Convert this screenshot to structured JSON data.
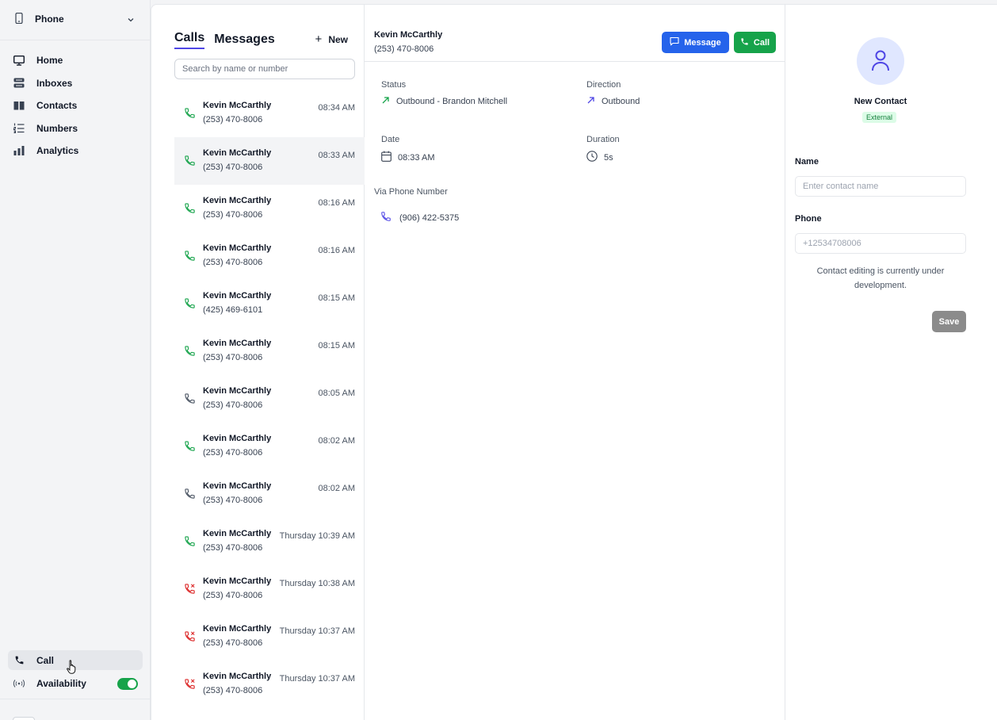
{
  "sidebar": {
    "workspace": {
      "label": "Phone",
      "icon": "mobile-phone-icon"
    },
    "nav": [
      {
        "label": "Home",
        "icon": "monitor-icon"
      },
      {
        "label": "Inboxes",
        "icon": "inbox-stack-icon"
      },
      {
        "label": "Contacts",
        "icon": "book-icon"
      },
      {
        "label": "Numbers",
        "icon": "numbered-list-icon"
      },
      {
        "label": "Analytics",
        "icon": "bar-chart-icon"
      }
    ],
    "call_label": "Call",
    "availability_label": "Availability",
    "availability_on": true
  },
  "list": {
    "tabs": [
      "Calls",
      "Messages"
    ],
    "active_tab": "Calls",
    "new_label": "New",
    "search_placeholder": "Search by name or number",
    "calls": [
      {
        "name": "Kevin McCarthly",
        "number": "(253) 470-8006",
        "time": "08:34 AM",
        "status": "connected",
        "selected": false
      },
      {
        "name": "Kevin McCarthly",
        "number": "(253) 470-8006",
        "time": "08:33 AM",
        "status": "connected",
        "selected": true
      },
      {
        "name": "Kevin McCarthly",
        "number": "(253) 470-8006",
        "time": "08:16 AM",
        "status": "connected",
        "selected": false
      },
      {
        "name": "Kevin McCarthly",
        "number": "(253) 470-8006",
        "time": "08:16 AM",
        "status": "connected",
        "selected": false
      },
      {
        "name": "Kevin McCarthly",
        "number": "(425) 469-6101",
        "time": "08:15 AM",
        "status": "connected",
        "selected": false
      },
      {
        "name": "Kevin McCarthly",
        "number": "(253) 470-8006",
        "time": "08:15 AM",
        "status": "connected",
        "selected": false
      },
      {
        "name": "Kevin McCarthly",
        "number": "(253) 470-8006",
        "time": "08:05 AM",
        "status": "neutral",
        "selected": false
      },
      {
        "name": "Kevin McCarthly",
        "number": "(253) 470-8006",
        "time": "08:02 AM",
        "status": "connected",
        "selected": false
      },
      {
        "name": "Kevin McCarthly",
        "number": "(253) 470-8006",
        "time": "08:02 AM",
        "status": "neutral",
        "selected": false
      },
      {
        "name": "Kevin McCarthly",
        "number": "(253) 470-8006",
        "time": "Thursday 10:39 AM",
        "status": "connected",
        "selected": false
      },
      {
        "name": "Kevin McCarthly",
        "number": "(253) 470-8006",
        "time": "Thursday 10:38 AM",
        "status": "missed",
        "selected": false
      },
      {
        "name": "Kevin McCarthly",
        "number": "(253) 470-8006",
        "time": "Thursday 10:37 AM",
        "status": "missed",
        "selected": false
      },
      {
        "name": "Kevin McCarthly",
        "number": "(253) 470-8006",
        "time": "Thursday 10:37 AM",
        "status": "missed",
        "selected": false
      }
    ]
  },
  "detail": {
    "name": "Kevin McCarthly",
    "number": "(253) 470-8006",
    "message_label": "Message",
    "call_label": "Call",
    "status_label": "Status",
    "status_value": "Outbound - Brandon Mitchell",
    "direction_label": "Direction",
    "direction_value": "Outbound",
    "date_label": "Date",
    "date_value": "08:33 AM",
    "duration_label": "Duration",
    "duration_value": "5s",
    "via_label": "Via Phone Number",
    "via_value": "(906) 422-5375"
  },
  "contact": {
    "title": "New Contact",
    "badge": "External",
    "name_label": "Name",
    "name_placeholder": "Enter contact name",
    "name_value": "",
    "phone_label": "Phone",
    "phone_placeholder": "+12534708006",
    "phone_value": "",
    "note": "Contact editing is currently under development.",
    "save_label": "Save"
  },
  "colors": {
    "primary_blue": "#2563eb",
    "success_green": "#16a34a",
    "missed_red": "#dc2626",
    "accent_indigo": "#4f46e5"
  }
}
